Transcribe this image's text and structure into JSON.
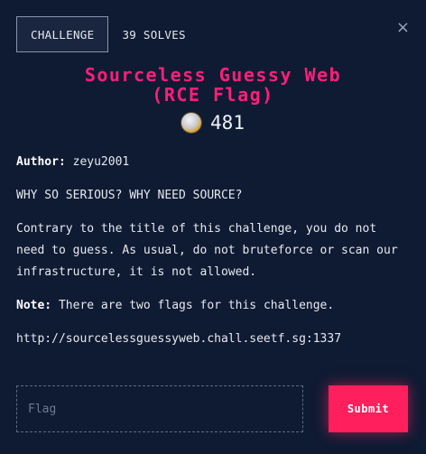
{
  "tabs": [
    {
      "label": "CHALLENGE",
      "active": true
    },
    {
      "label": "39 SOLVES",
      "active": false
    }
  ],
  "close_icon": "×",
  "challenge": {
    "title_line1": "Sourceless Guessy Web",
    "title_line2": "(RCE Flag)",
    "points": "481",
    "author_label": "Author:",
    "author": "zeyu2001",
    "tagline": "WHY SO SERIOUS? WHY NEED SOURCE?",
    "description_line1": "Contrary to the title of this challenge, you do not",
    "description_line2": "need to guess. As usual, do not bruteforce or scan our",
    "description_line3": "infrastructure, it is not allowed.",
    "note_label": "Note:",
    "note": "There are two flags for this challenge.",
    "url": "http://sourcelessguessyweb.chall.seetf.sg:1337"
  },
  "form": {
    "flag_placeholder": "Flag",
    "submit_label": "Submit"
  },
  "colors": {
    "background": "#0f1b33",
    "accent": "#ff1f5c",
    "title": "#ff1f7a"
  }
}
